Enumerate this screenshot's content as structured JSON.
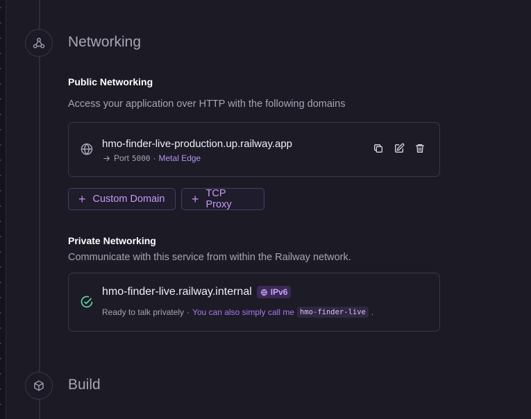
{
  "sections": {
    "networking": {
      "title": "Networking",
      "icon": "network-icon"
    },
    "build": {
      "title": "Build",
      "icon": "cube-icon"
    }
  },
  "public_networking": {
    "heading": "Public Networking",
    "description": "Access your application over HTTP with the following domains",
    "domain": {
      "name": "hmo-finder-live-production.up.railway.app",
      "port_label": "Port",
      "port_value": "5000",
      "separator": "·",
      "edge_label": "Metal Edge"
    },
    "buttons": {
      "custom_domain": "Custom Domain",
      "tcp_proxy": "TCP Proxy"
    }
  },
  "private_networking": {
    "heading": "Private Networking",
    "description": "Communicate with this service from within the Railway network.",
    "internal": {
      "name": "hmo-finder-live.railway.internal",
      "badge": "IPv6",
      "status_text": "Ready to talk privately",
      "separator": "·",
      "hint_text": "You can also simply call me",
      "short_name": "hmo-finder-live",
      "trailing": "."
    }
  },
  "colors": {
    "background": "#1b1a25",
    "accent": "#b893f0",
    "success": "#5fd6a5"
  }
}
